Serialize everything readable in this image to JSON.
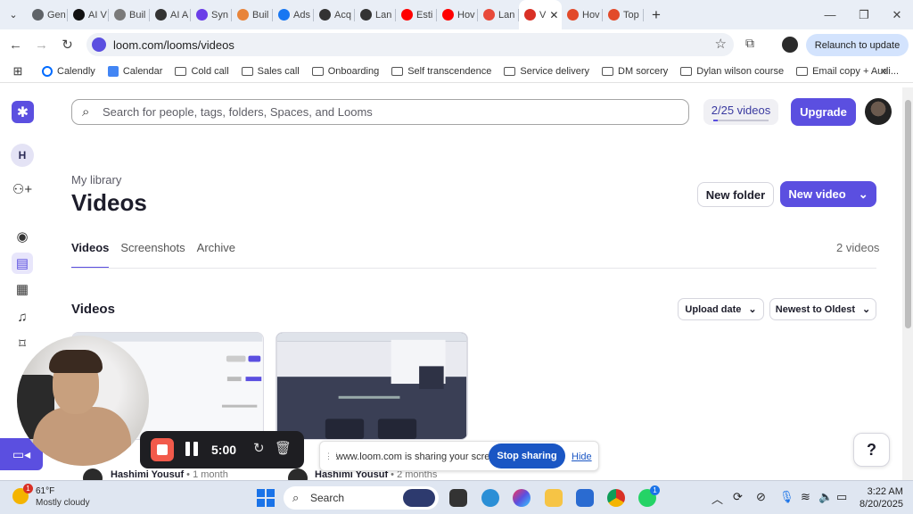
{
  "browser": {
    "tabs": [
      {
        "label": "Gen",
        "color": "#5f6368"
      },
      {
        "label": "AI V",
        "color": "#111111"
      },
      {
        "label": "Buil",
        "color": "#7a7a7a"
      },
      {
        "label": "AI A",
        "color": "#333333"
      },
      {
        "label": "Syn",
        "color": "#6a3de8"
      },
      {
        "label": "Buil",
        "color": "#e8843a"
      },
      {
        "label": "Ads",
        "color": "#1877f2"
      },
      {
        "label": "Acq",
        "color": "#333333"
      },
      {
        "label": "Lan",
        "color": "#333333"
      },
      {
        "label": "Esti",
        "color": "#ff0000"
      },
      {
        "label": "Hov",
        "color": "#ff0000"
      },
      {
        "label": "Lan",
        "color": "#e84a3a"
      },
      {
        "label": "V",
        "color": "#d93025",
        "active": true
      },
      {
        "label": "Hov",
        "color": "#e24a2a"
      },
      {
        "label": "Top",
        "color": "#e24a2a"
      }
    ],
    "url": "loom.com/looms/videos",
    "relaunch_label": "Relaunch to update",
    "bookmarks": [
      {
        "label": "Calendly",
        "icon": "calendly-icon"
      },
      {
        "label": "Calendar",
        "icon": "calendar-icon"
      },
      {
        "label": "Cold call",
        "icon": "folder-icon"
      },
      {
        "label": "Sales call",
        "icon": "folder-icon"
      },
      {
        "label": "Onboarding",
        "icon": "folder-icon"
      },
      {
        "label": "Self transcendence",
        "icon": "folder-icon"
      },
      {
        "label": "Service delivery",
        "icon": "folder-icon"
      },
      {
        "label": "DM sorcery",
        "icon": "folder-icon"
      },
      {
        "label": "Dylan wilson course",
        "icon": "folder-icon"
      },
      {
        "label": "Email copy + Audi...",
        "icon": "folder-icon"
      }
    ]
  },
  "loom": {
    "workspace_initial": "H",
    "search_placeholder": "Search for people, tags, folders, Spaces, and Looms",
    "video_quota": "2/25 videos",
    "video_quota_fraction": 0.08,
    "upgrade_label": "Upgrade",
    "library_label": "My library",
    "page_title": "Videos",
    "new_folder_label": "New folder",
    "new_video_label": "New video",
    "tabs": [
      "Videos",
      "Screenshots",
      "Archive"
    ],
    "video_count": "2 videos",
    "section_title": "Videos",
    "sort_field": "Upload date",
    "sort_order": "Newest to Oldest",
    "cards": [
      {
        "author": "Hashimi Yousuf",
        "ago": "1 month"
      },
      {
        "author": "Hashimi Yousuf",
        "ago": "2 months"
      }
    ],
    "help_label": "?"
  },
  "recorder": {
    "time": "5:00"
  },
  "share_bar": {
    "message": "www.loom.com is sharing your screen.",
    "stop_label": "Stop sharing",
    "hide_label": "Hide"
  },
  "taskbar": {
    "temperature": "61°F",
    "condition": "Mostly cloudy",
    "search_label": "Search",
    "time": "3:22 AM",
    "date": "8/20/2025",
    "weather_badge": "1",
    "whatsapp_badge": "1"
  },
  "colors": {
    "accent": "#5b4fe0",
    "recorder_stop": "#f25a4b",
    "share_button": "#1a56c4"
  }
}
